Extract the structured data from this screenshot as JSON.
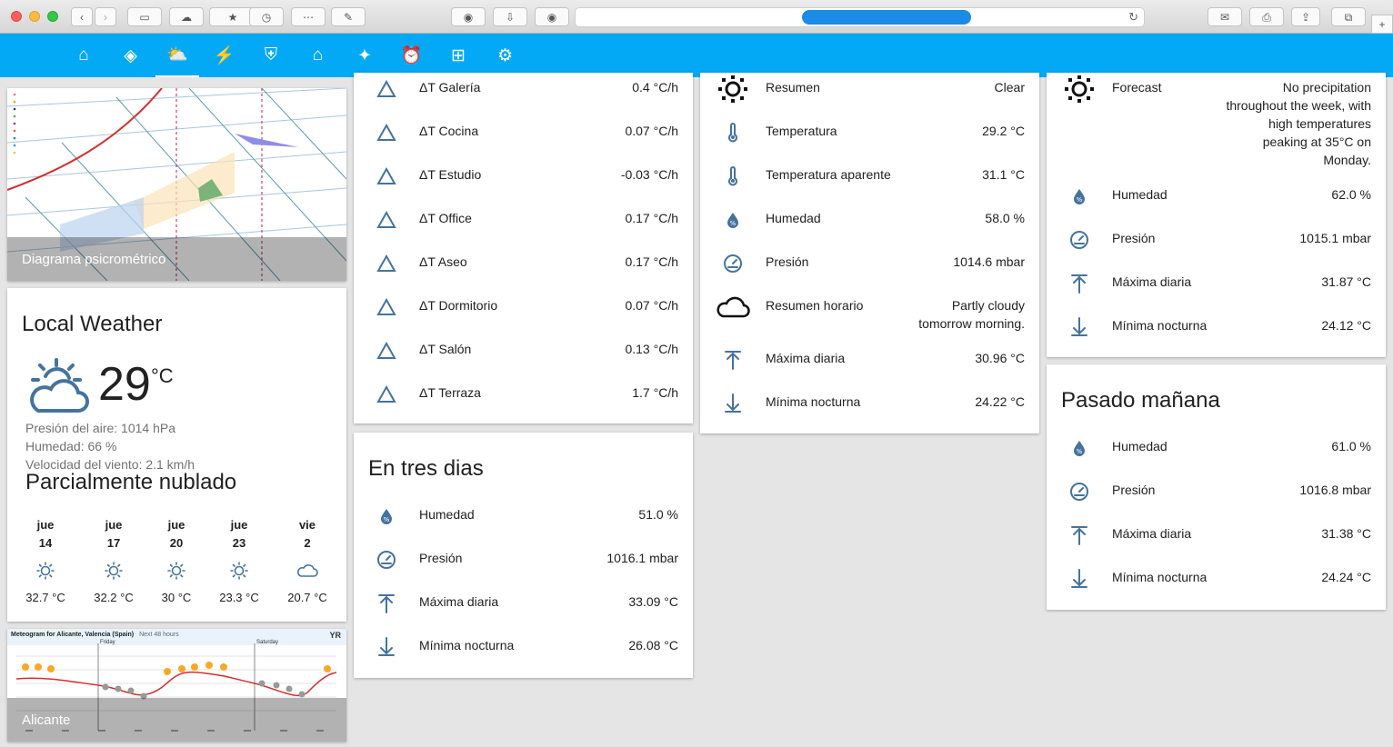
{
  "nav": {
    "icons": [
      "home-icon",
      "kodi-icon",
      "weather-icon",
      "energy-icon",
      "security-icon",
      "garden-icon",
      "automation-icon",
      "alarm-icon",
      "network-icon",
      "settings-icon"
    ],
    "active": 2
  },
  "psychro": {
    "caption": "Diagrama psicrométrico"
  },
  "local": {
    "title": "Local Weather",
    "temp": "29",
    "unit": "°C",
    "pressure": "Presión del aire: 1014 hPa",
    "humidity": "Humedad: 66 %",
    "wind": "Velocidad del viento: 2.1 km/h",
    "condition": "Parcialmente nublado",
    "forecast": [
      {
        "day": "jue",
        "date": "14",
        "icon": "sun-icon",
        "temp": "32.7 °C"
      },
      {
        "day": "jue",
        "date": "17",
        "icon": "sun-icon",
        "temp": "32.2 °C"
      },
      {
        "day": "jue",
        "date": "20",
        "icon": "sun-icon",
        "temp": "30 °C"
      },
      {
        "day": "jue",
        "date": "23",
        "icon": "sun-icon",
        "temp": "23.3 °C"
      },
      {
        "day": "vie",
        "date": "2",
        "icon": "cloud-icon",
        "temp": "20.7 °C"
      }
    ]
  },
  "meteogram": {
    "header": "Meteogram for Alicante, Valencia (Spain)",
    "sub": "Next 48 hours",
    "day1": "Friday",
    "day2": "Saturday",
    "logo": "YR",
    "caption": "Alicante"
  },
  "deltas": [
    {
      "label": "ΔT Galería",
      "value": "0.4 °C/h"
    },
    {
      "label": "ΔT Cocina",
      "value": "0.07 °C/h"
    },
    {
      "label": "ΔT Estudio",
      "value": "-0.03 °C/h"
    },
    {
      "label": "ΔT Office",
      "value": "0.17 °C/h"
    },
    {
      "label": "ΔT Aseo",
      "value": "0.17 °C/h"
    },
    {
      "label": "ΔT Dormitorio",
      "value": "0.07 °C/h"
    },
    {
      "label": "ΔT Salón",
      "value": "0.13 °C/h"
    },
    {
      "label": "ΔT Terraza",
      "value": "1.7 °C/h"
    }
  ],
  "tres": {
    "title": "En tres dias",
    "rows": [
      {
        "label": "Humedad",
        "value": "51.0 %"
      },
      {
        "label": "Presión",
        "value": "1016.1 mbar"
      },
      {
        "label": "Máxima diaria",
        "value": "33.09 °C"
      },
      {
        "label": "Mínima nocturna",
        "value": "26.08 °C"
      }
    ]
  },
  "today": {
    "rows": [
      {
        "label": "Resumen",
        "value": "Clear"
      },
      {
        "label": "Temperatura",
        "value": "29.2 °C"
      },
      {
        "label": "Temperatura aparente",
        "value": "31.1 °C"
      },
      {
        "label": "Humedad",
        "value": "58.0 %"
      },
      {
        "label": "Presión",
        "value": "1014.6 mbar"
      },
      {
        "label": "Resumen horario",
        "value": "Partly cloudy tomorrow morning."
      },
      {
        "label": "Máxima diaria",
        "value": "30.96 °C"
      },
      {
        "label": "Mínima nocturna",
        "value": "24.22 °C"
      }
    ]
  },
  "tomorrow": {
    "rows": [
      {
        "label": "Forecast",
        "value": "No precipitation throughout the week, with high temperatures peaking at 35°C on Monday."
      },
      {
        "label": "Humedad",
        "value": "62.0 %"
      },
      {
        "label": "Presión",
        "value": "1015.1 mbar"
      },
      {
        "label": "Máxima diaria",
        "value": "31.87 °C"
      },
      {
        "label": "Mínima nocturna",
        "value": "24.12 °C"
      }
    ]
  },
  "pasado": {
    "title": "Pasado mañana",
    "rows": [
      {
        "label": "Humedad",
        "value": "61.0 %"
      },
      {
        "label": "Presión",
        "value": "1016.8 mbar"
      },
      {
        "label": "Máxima diaria",
        "value": "31.38 °C"
      },
      {
        "label": "Mínima nocturna",
        "value": "24.24 °C"
      }
    ]
  }
}
